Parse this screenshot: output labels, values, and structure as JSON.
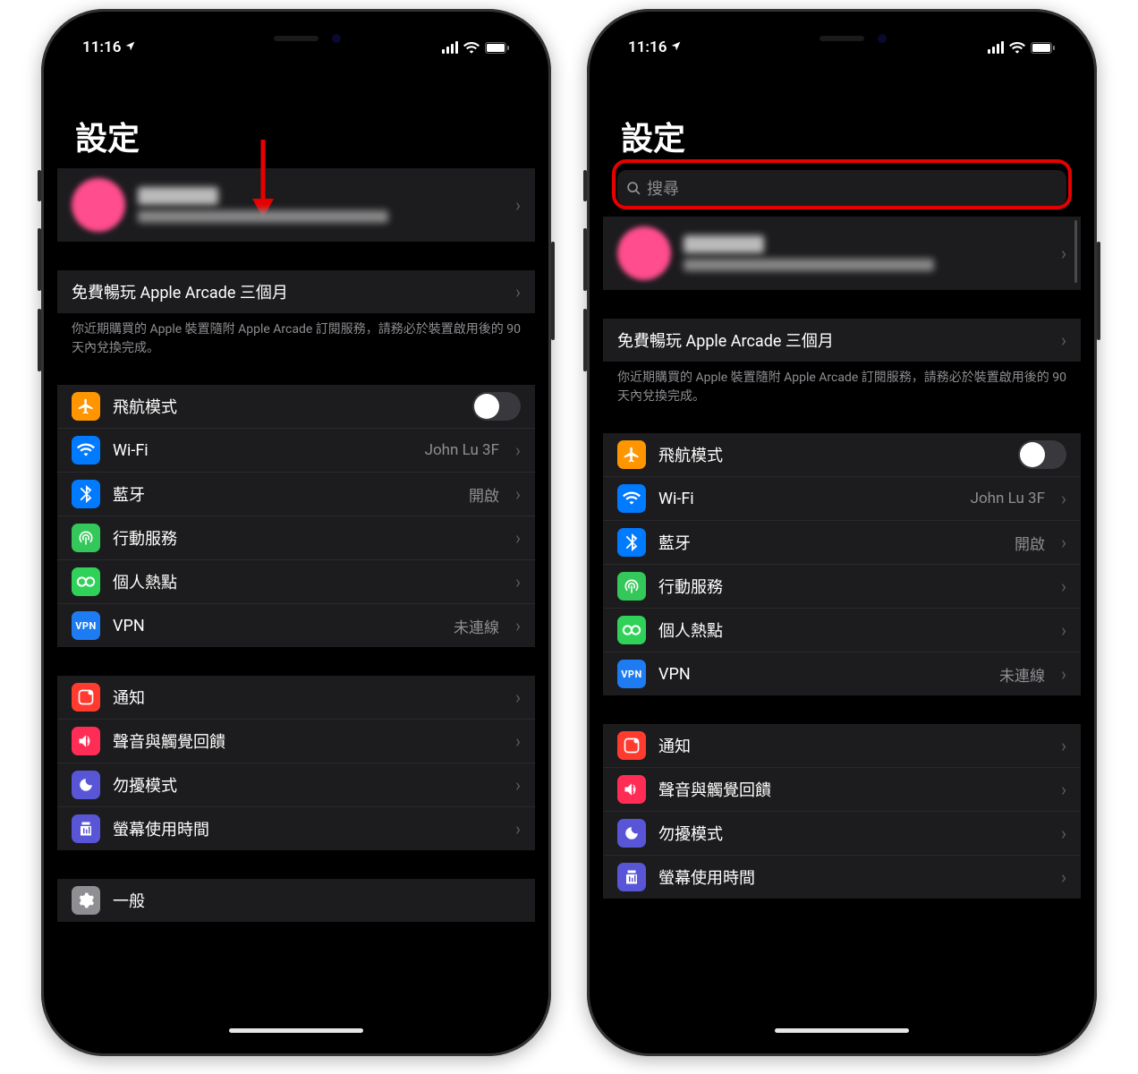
{
  "status": {
    "time": "11:16",
    "location_arrow": "➤"
  },
  "title": "設定",
  "search_placeholder": "搜尋",
  "promo": {
    "label": "免費暢玩 Apple Arcade 三個月",
    "note": "你近期購買的 Apple 裝置隨附 Apple Arcade 訂閱服務，請務必於裝置啟用後的 90 天內兌換完成。"
  },
  "rows": {
    "airplane": "飛航模式",
    "wifi": "Wi-Fi",
    "wifi_detail": "John Lu 3F",
    "bluetooth": "藍牙",
    "bluetooth_detail": "開啟",
    "cellular": "行動服務",
    "hotspot": "個人熱點",
    "vpn": "VPN",
    "vpn_detail": "未連線",
    "notifications": "通知",
    "sounds": "聲音與觸覺回饋",
    "dnd": "勿擾模式",
    "screentime": "螢幕使用時間",
    "general": "一般"
  },
  "icons": {
    "airplane": "airplane-icon",
    "wifi": "wifi-icon",
    "bluetooth": "bluetooth-icon",
    "cellular": "cellular-icon",
    "hotspot": "hotspot-icon",
    "vpn_text": "VPN",
    "notifications": "notifications-icon",
    "sounds": "sounds-icon",
    "dnd": "dnd-icon",
    "screentime": "screentime-icon",
    "general": "general-icon"
  }
}
